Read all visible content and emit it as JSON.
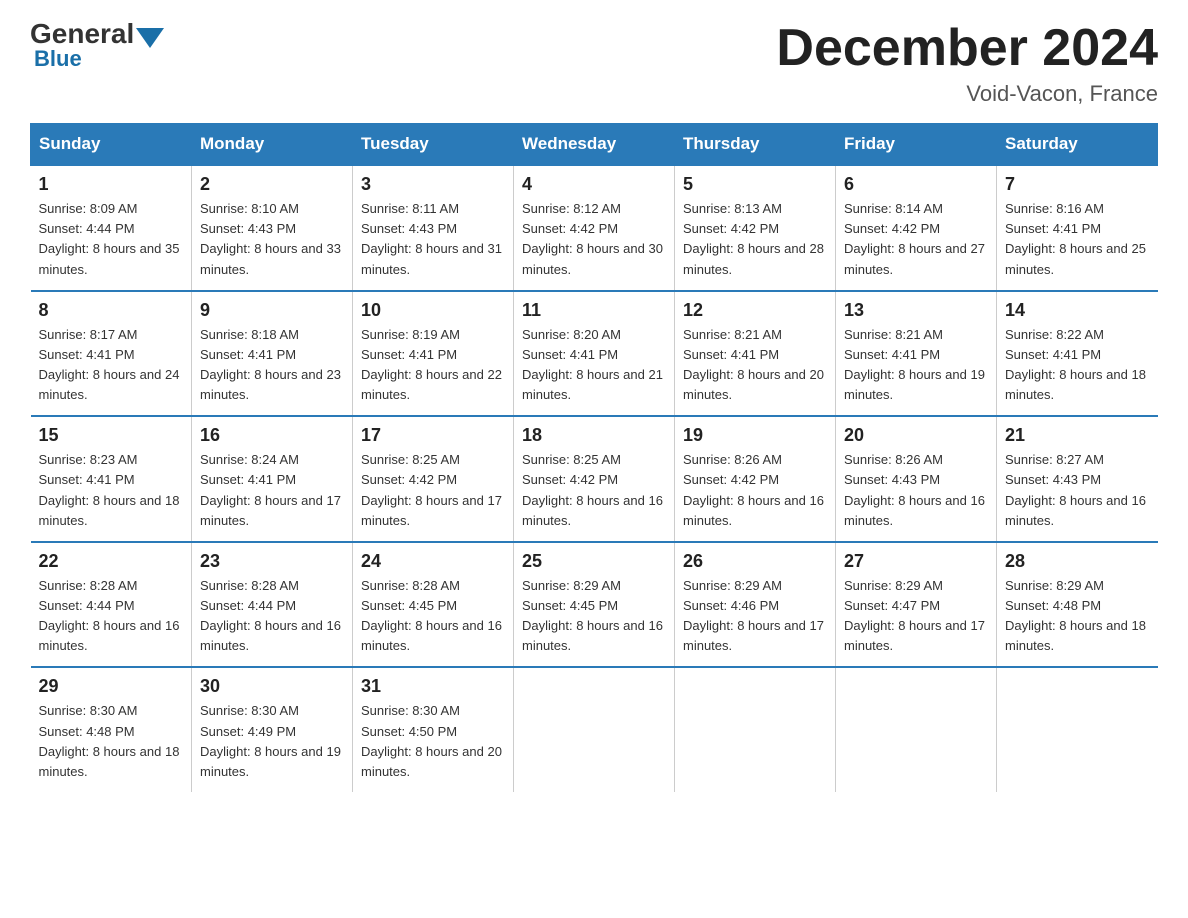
{
  "logo": {
    "general": "General",
    "blue": "Blue"
  },
  "title": "December 2024",
  "subtitle": "Void-Vacon, France",
  "days_of_week": [
    "Sunday",
    "Monday",
    "Tuesday",
    "Wednesday",
    "Thursday",
    "Friday",
    "Saturday"
  ],
  "weeks": [
    [
      {
        "day": "1",
        "sunrise": "8:09 AM",
        "sunset": "4:44 PM",
        "daylight": "8 hours and 35 minutes."
      },
      {
        "day": "2",
        "sunrise": "8:10 AM",
        "sunset": "4:43 PM",
        "daylight": "8 hours and 33 minutes."
      },
      {
        "day": "3",
        "sunrise": "8:11 AM",
        "sunset": "4:43 PM",
        "daylight": "8 hours and 31 minutes."
      },
      {
        "day": "4",
        "sunrise": "8:12 AM",
        "sunset": "4:42 PM",
        "daylight": "8 hours and 30 minutes."
      },
      {
        "day": "5",
        "sunrise": "8:13 AM",
        "sunset": "4:42 PM",
        "daylight": "8 hours and 28 minutes."
      },
      {
        "day": "6",
        "sunrise": "8:14 AM",
        "sunset": "4:42 PM",
        "daylight": "8 hours and 27 minutes."
      },
      {
        "day": "7",
        "sunrise": "8:16 AM",
        "sunset": "4:41 PM",
        "daylight": "8 hours and 25 minutes."
      }
    ],
    [
      {
        "day": "8",
        "sunrise": "8:17 AM",
        "sunset": "4:41 PM",
        "daylight": "8 hours and 24 minutes."
      },
      {
        "day": "9",
        "sunrise": "8:18 AM",
        "sunset": "4:41 PM",
        "daylight": "8 hours and 23 minutes."
      },
      {
        "day": "10",
        "sunrise": "8:19 AM",
        "sunset": "4:41 PM",
        "daylight": "8 hours and 22 minutes."
      },
      {
        "day": "11",
        "sunrise": "8:20 AM",
        "sunset": "4:41 PM",
        "daylight": "8 hours and 21 minutes."
      },
      {
        "day": "12",
        "sunrise": "8:21 AM",
        "sunset": "4:41 PM",
        "daylight": "8 hours and 20 minutes."
      },
      {
        "day": "13",
        "sunrise": "8:21 AM",
        "sunset": "4:41 PM",
        "daylight": "8 hours and 19 minutes."
      },
      {
        "day": "14",
        "sunrise": "8:22 AM",
        "sunset": "4:41 PM",
        "daylight": "8 hours and 18 minutes."
      }
    ],
    [
      {
        "day": "15",
        "sunrise": "8:23 AM",
        "sunset": "4:41 PM",
        "daylight": "8 hours and 18 minutes."
      },
      {
        "day": "16",
        "sunrise": "8:24 AM",
        "sunset": "4:41 PM",
        "daylight": "8 hours and 17 minutes."
      },
      {
        "day": "17",
        "sunrise": "8:25 AM",
        "sunset": "4:42 PM",
        "daylight": "8 hours and 17 minutes."
      },
      {
        "day": "18",
        "sunrise": "8:25 AM",
        "sunset": "4:42 PM",
        "daylight": "8 hours and 16 minutes."
      },
      {
        "day": "19",
        "sunrise": "8:26 AM",
        "sunset": "4:42 PM",
        "daylight": "8 hours and 16 minutes."
      },
      {
        "day": "20",
        "sunrise": "8:26 AM",
        "sunset": "4:43 PM",
        "daylight": "8 hours and 16 minutes."
      },
      {
        "day": "21",
        "sunrise": "8:27 AM",
        "sunset": "4:43 PM",
        "daylight": "8 hours and 16 minutes."
      }
    ],
    [
      {
        "day": "22",
        "sunrise": "8:28 AM",
        "sunset": "4:44 PM",
        "daylight": "8 hours and 16 minutes."
      },
      {
        "day": "23",
        "sunrise": "8:28 AM",
        "sunset": "4:44 PM",
        "daylight": "8 hours and 16 minutes."
      },
      {
        "day": "24",
        "sunrise": "8:28 AM",
        "sunset": "4:45 PM",
        "daylight": "8 hours and 16 minutes."
      },
      {
        "day": "25",
        "sunrise": "8:29 AM",
        "sunset": "4:45 PM",
        "daylight": "8 hours and 16 minutes."
      },
      {
        "day": "26",
        "sunrise": "8:29 AM",
        "sunset": "4:46 PM",
        "daylight": "8 hours and 17 minutes."
      },
      {
        "day": "27",
        "sunrise": "8:29 AM",
        "sunset": "4:47 PM",
        "daylight": "8 hours and 17 minutes."
      },
      {
        "day": "28",
        "sunrise": "8:29 AM",
        "sunset": "4:48 PM",
        "daylight": "8 hours and 18 minutes."
      }
    ],
    [
      {
        "day": "29",
        "sunrise": "8:30 AM",
        "sunset": "4:48 PM",
        "daylight": "8 hours and 18 minutes."
      },
      {
        "day": "30",
        "sunrise": "8:30 AM",
        "sunset": "4:49 PM",
        "daylight": "8 hours and 19 minutes."
      },
      {
        "day": "31",
        "sunrise": "8:30 AM",
        "sunset": "4:50 PM",
        "daylight": "8 hours and 20 minutes."
      },
      null,
      null,
      null,
      null
    ]
  ]
}
